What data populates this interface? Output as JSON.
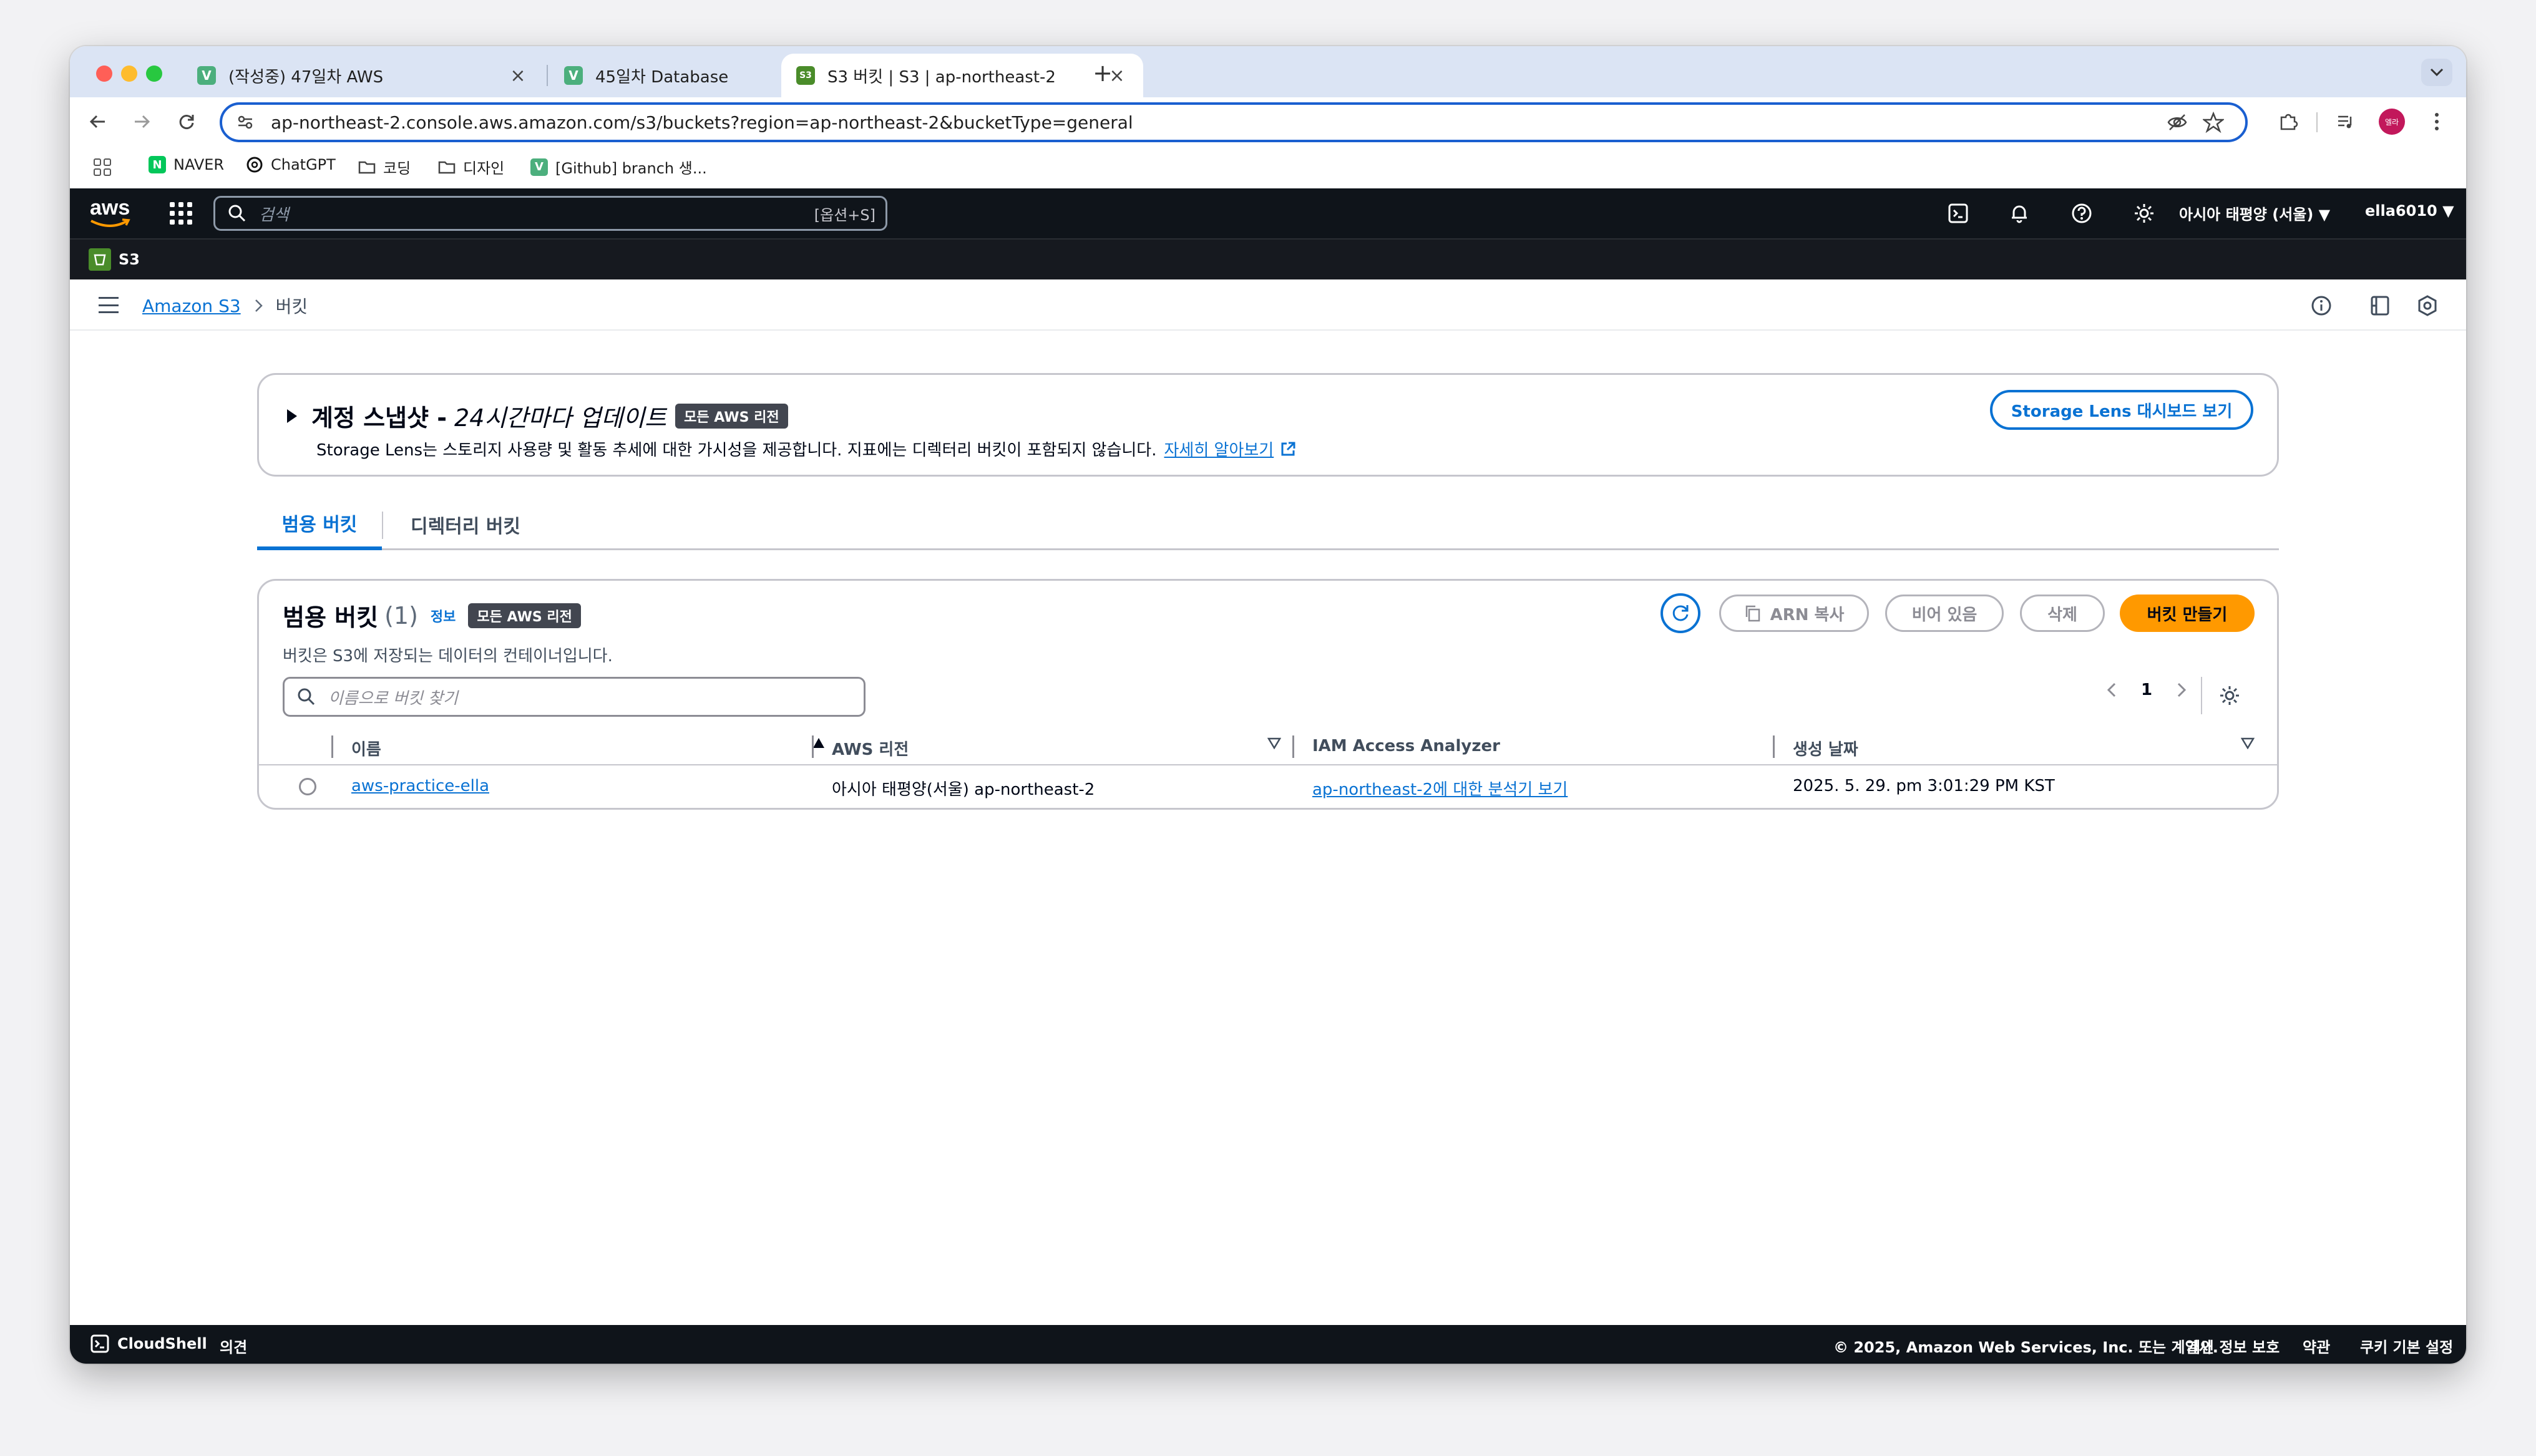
{
  "browser": {
    "tabs": [
      {
        "title": "(작성중) 47일차 AWS",
        "fav": "V",
        "fav_color": "#4caf7d"
      },
      {
        "title": "45일차 Database",
        "fav": "V",
        "fav_color": "#4caf7d"
      },
      {
        "title": "S3 버킷 | S3 | ap-northeast-2",
        "fav": "S3",
        "fav_color": "#4a8c2a"
      }
    ],
    "url": "ap-northeast-2.console.aws.amazon.com/s3/buckets?region=ap-northeast-2&bucketType=general",
    "profile_initials": "엘라",
    "bookmarks": [
      {
        "label": "NAVER",
        "icon": "naver-icon"
      },
      {
        "label": "ChatGPT",
        "icon": "chatgpt-icon"
      },
      {
        "label": "코딩",
        "icon": "folder-icon"
      },
      {
        "label": "디자인",
        "icon": "folder-icon"
      },
      {
        "label": "[Github] branch 생...",
        "icon": "velog-icon"
      }
    ]
  },
  "aws_nav": {
    "logo": "aws",
    "search_placeholder": "검색",
    "search_shortcut": "[옵션+S]",
    "region": "아시아 태평양 (서울) ▼",
    "account": "ella6010 ▼",
    "service_label": "S3"
  },
  "breadcrumb": {
    "root": "Amazon S3",
    "current": "버킷"
  },
  "snapshot": {
    "title": "계정 스냅샷 -",
    "title_italic": "24시간마다 업데이트",
    "badge": "모든 AWS 리전",
    "desc": "Storage Lens는 스토리지 사용량 및 활동 추세에 대한 가시성을 제공합니다. 지표에는 디렉터리 버킷이 포함되지 않습니다.",
    "learn_more": "자세히 알아보기",
    "dashboard_button": "Storage Lens 대시보드 보기"
  },
  "tabs": [
    {
      "label": "범용 버킷",
      "active": true
    },
    {
      "label": "디렉터리 버킷",
      "active": false
    }
  ],
  "buckets_panel": {
    "title": "범용 버킷",
    "count": "(1)",
    "info": "정보",
    "badge": "모든 AWS 리전",
    "desc": "버킷은 S3에 저장되는 데이터의 컨테이너입니다.",
    "search_placeholder": "이름으로 버킷 찾기",
    "buttons": {
      "copy_arn": "ARN 복사",
      "empty": "비어 있음",
      "delete": "삭제",
      "create": "버킷 만들기"
    },
    "page": "1",
    "columns": [
      "이름",
      "AWS 리전",
      "IAM Access Analyzer",
      "생성 날짜"
    ],
    "rows": [
      {
        "name": "aws-practice-ella",
        "region": "아시아 태평양(서울) ap-northeast-2",
        "analyzer": "ap-northeast-2에 대한 분석기 보기",
        "created": "2025. 5. 29. pm 3:01:29 PM KST"
      }
    ]
  },
  "footer": {
    "cloudshell": "CloudShell",
    "feedback": "의견",
    "copyright": "© 2025, Amazon Web Services, Inc. 또는 계열사.",
    "privacy": "개인 정보 보호",
    "terms": "약관",
    "cookies": "쿠키 기본 설정"
  },
  "colors": {
    "accent_blue": "#0972d3",
    "primary_orange": "#ff9900",
    "nav_dark": "#0f141a",
    "omnibox_focus": "#1a5fd0"
  }
}
